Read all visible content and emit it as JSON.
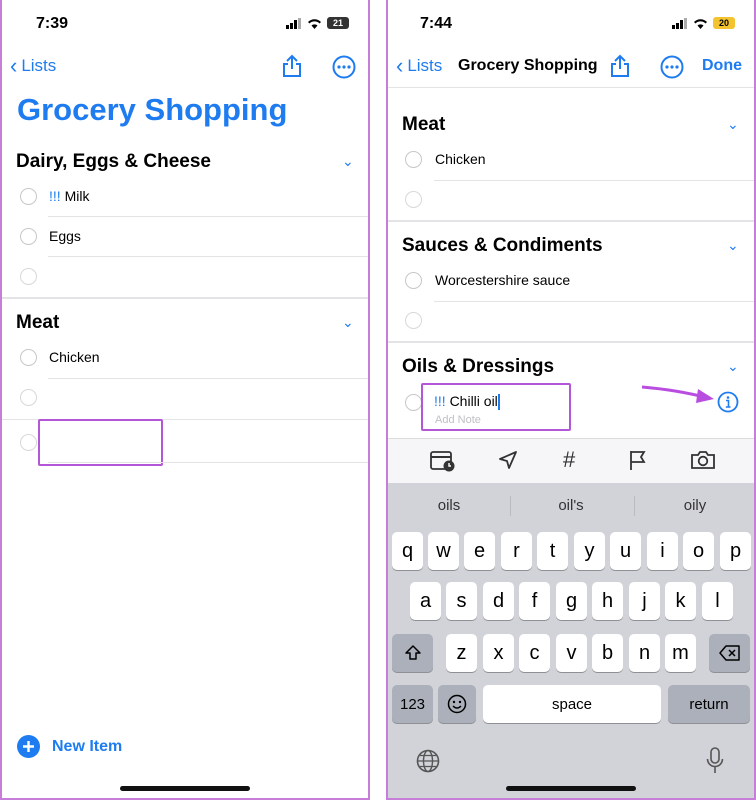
{
  "left": {
    "status": {
      "time": "7:39",
      "battery": "21"
    },
    "nav": {
      "back_label": "Lists"
    },
    "title": "Grocery Shopping",
    "sections": [
      {
        "name": "Dairy, Eggs & Cheese",
        "items": [
          {
            "priority": "!!!",
            "text": "Milk"
          },
          {
            "priority": "",
            "text": "Eggs"
          }
        ]
      },
      {
        "name": "Meat",
        "items": [
          {
            "priority": "",
            "text": "Chicken"
          }
        ]
      }
    ],
    "new_item_label": "New Item"
  },
  "right": {
    "status": {
      "time": "7:44",
      "battery": "20"
    },
    "nav": {
      "back_label": "Lists",
      "title": "Grocery Shopping",
      "done_label": "Done"
    },
    "sections": [
      {
        "name": "Meat",
        "items": [
          {
            "text": "Chicken"
          }
        ]
      },
      {
        "name": "Sauces & Condiments",
        "items": [
          {
            "text": "Worcestershire sauce"
          }
        ]
      },
      {
        "name": "Oils & Dressings",
        "items": [
          {
            "priority": "!!!",
            "text": "Chilli oil",
            "note_placeholder": "Add Note"
          }
        ]
      }
    ],
    "suggestions": [
      "oils",
      "oil's",
      "oily"
    ],
    "keyboard": {
      "row1": [
        "q",
        "w",
        "e",
        "r",
        "t",
        "y",
        "u",
        "i",
        "o",
        "p"
      ],
      "row2": [
        "a",
        "s",
        "d",
        "f",
        "g",
        "h",
        "j",
        "k",
        "l"
      ],
      "row3": [
        "z",
        "x",
        "c",
        "v",
        "b",
        "n",
        "m"
      ],
      "numbers_label": "123",
      "space_label": "space",
      "return_label": "return"
    }
  },
  "colors": {
    "accent": "#1e7cf0",
    "highlight": "#b456d8"
  }
}
